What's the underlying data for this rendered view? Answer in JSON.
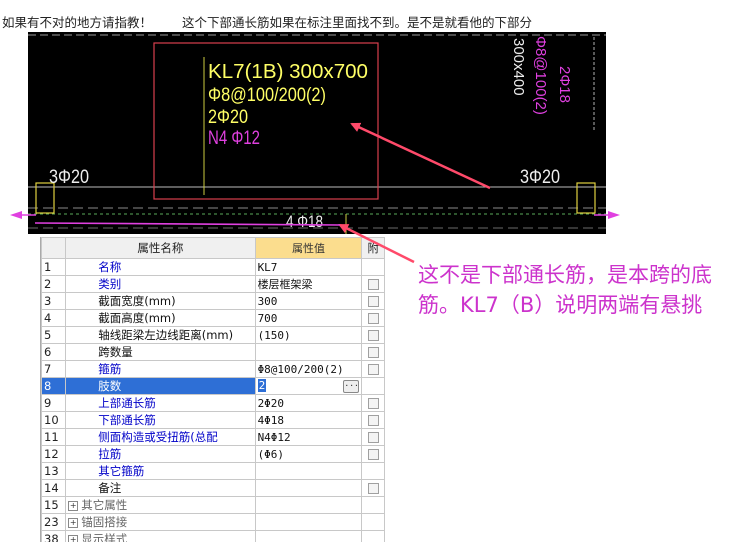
{
  "question": {
    "part1": "如果有不对的地方请指教！",
    "part2": "这个下部通长筋如果在标注里面找不到。是不是就看他的下部分"
  },
  "cad": {
    "beam_label": "KL7(1B) 300x700",
    "stirrup": "Φ8@100/200(2)",
    "top_bar": "2Φ20",
    "side_bar": "N4 Φ12",
    "left_support": "3Φ20",
    "right_support": "3Φ20",
    "bottom_bar": "4 Φ18",
    "right_v1": "Φ8@100(2)",
    "right_v2": "300x400",
    "right_v3": "2Φ18"
  },
  "table": {
    "headers": {
      "num": "",
      "name": "属性名称",
      "value": "属性值",
      "attach": "附"
    },
    "rows": [
      {
        "num": "1",
        "name": "名称",
        "value": "KL7",
        "style": "link",
        "chk": false
      },
      {
        "num": "2",
        "name": "类别",
        "value": "楼层框架梁",
        "style": "link",
        "chk": true
      },
      {
        "num": "3",
        "name": "截面宽度(mm)",
        "value": "300",
        "style": "plain",
        "chk": true
      },
      {
        "num": "4",
        "name": "截面高度(mm)",
        "value": "700",
        "style": "plain",
        "chk": true
      },
      {
        "num": "5",
        "name": "轴线距梁左边线距离(mm)",
        "value": "(150)",
        "style": "plain",
        "chk": true
      },
      {
        "num": "6",
        "name": "跨数量",
        "value": "",
        "style": "plain",
        "chk": true
      },
      {
        "num": "7",
        "name": "箍筋",
        "value": "Φ8@100/200(2)",
        "style": "link",
        "chk": true
      },
      {
        "num": "8",
        "name": "肢数",
        "value": "2",
        "style": "link",
        "chk": false,
        "selected": true
      },
      {
        "num": "9",
        "name": "上部通长筋",
        "value": "2Φ20",
        "style": "link",
        "chk": true
      },
      {
        "num": "10",
        "name": "下部通长筋",
        "value": "4Φ18",
        "style": "link",
        "chk": true
      },
      {
        "num": "11",
        "name": "侧面构造或受扭筋(总配",
        "value": "N4Φ12",
        "style": "link",
        "chk": true
      },
      {
        "num": "12",
        "name": "拉筋",
        "value": "(Φ6)",
        "style": "link",
        "chk": true
      },
      {
        "num": "13",
        "name": "其它箍筋",
        "value": "",
        "style": "link",
        "chk": false
      },
      {
        "num": "14",
        "name": "备注",
        "value": "",
        "style": "plain",
        "chk": true
      },
      {
        "num": "15",
        "name": "其它属性",
        "value": "",
        "style": "gray",
        "chk": false,
        "expand": "+"
      },
      {
        "num": "23",
        "name": "锚固搭接",
        "value": "",
        "style": "gray",
        "chk": false,
        "expand": "+"
      },
      {
        "num": "38",
        "name": "显示样式",
        "value": "",
        "style": "gray",
        "chk": false,
        "expand": "+"
      }
    ]
  },
  "answer": "这不是下部通长筋，是本跨的底筋。KL7（B）说明两端有悬挑",
  "colors": {
    "annotation": "#cc33cc",
    "arrow": "#ff4a6a",
    "selection": "#2e6fd6",
    "header_value": "#fbdd8e"
  }
}
